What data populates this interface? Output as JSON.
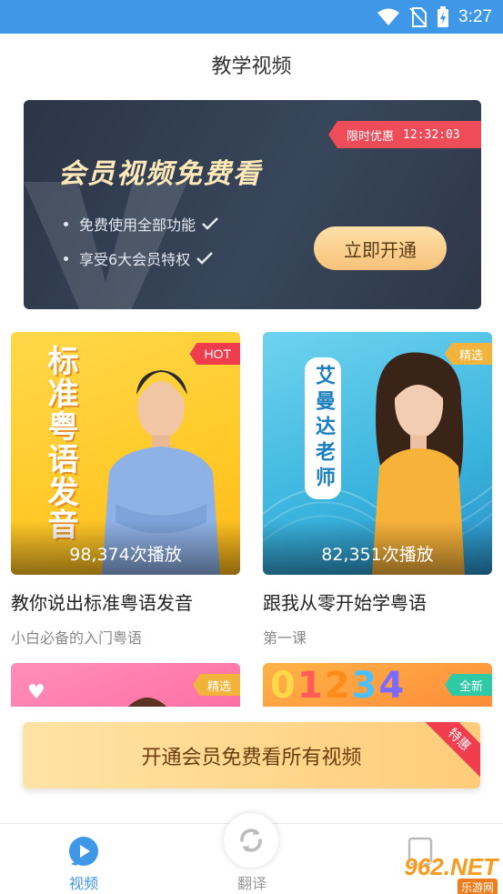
{
  "status_bar": {
    "time": "3:27",
    "icons": [
      "wifi-icon",
      "no-sim-icon",
      "battery-charging-icon"
    ]
  },
  "page": {
    "title": "教学视频"
  },
  "banner": {
    "ribbon_label": "限时优惠",
    "countdown": "12:32:03",
    "headline": "会员视频免费看",
    "perks": [
      "免费使用全部功能",
      "享受6大会员特权"
    ],
    "cta_label": "立即开通"
  },
  "videos": [
    {
      "badge": "HOT",
      "overlay_text": "标准粤语发音",
      "plays": "98,374次播放",
      "title": "教你说出标准粤语发音",
      "subtitle": "小白必备的入门粤语"
    },
    {
      "badge": "精选",
      "overlay_text": "艾曼达老师",
      "plays": "82,351次播放",
      "title": "跟我从零开始学粤语",
      "subtitle": "第一课"
    }
  ],
  "partial_videos": [
    {
      "badge": "精选"
    },
    {
      "badge": "全新",
      "overlay_text": "01234"
    }
  ],
  "promo": {
    "label": "开通会员免费看所有视频",
    "corner_label": "特惠"
  },
  "bottom_nav": {
    "items": [
      {
        "label": "视频",
        "icon": "play-circle-icon",
        "active": true
      },
      {
        "label": "翻译",
        "icon": "refresh-icon",
        "active": false
      }
    ]
  },
  "watermark": {
    "top": "962.NET",
    "bottom": "乐游网"
  },
  "colors": {
    "accent": "#3f97e8",
    "hot_badge": "#ef3d4e",
    "pick_badge": "#f2b33a",
    "new_badge": "#2fc9a6",
    "promo_text": "#6b3d0e"
  }
}
